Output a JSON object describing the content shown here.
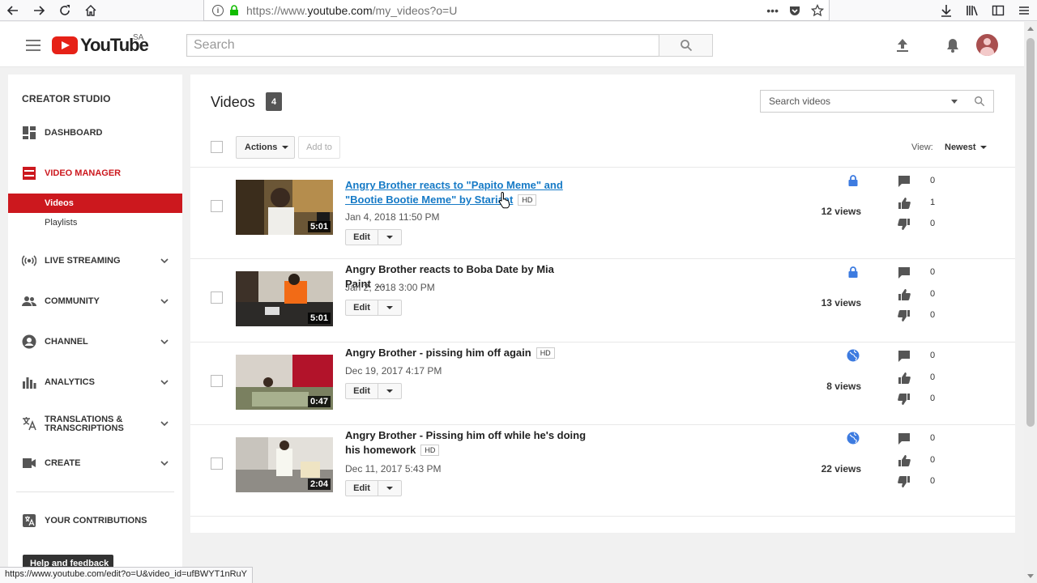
{
  "browser": {
    "url_prefix": "https://www.",
    "url_domain": "youtube.com",
    "url_path": "/my_videos?o=U",
    "status_url": "https://www.youtube.com/edit?o=U&video_id=ufBWYT1nRuY",
    "url_actions_more": "•••"
  },
  "header": {
    "logo_text": "YouTube",
    "region": "SA",
    "search_placeholder": "Search"
  },
  "sidebar": {
    "title": "CREATOR STUDIO",
    "items": [
      {
        "label": "DASHBOARD",
        "icon": "dashboard-icon"
      },
      {
        "label": "VIDEO MANAGER",
        "icon": "video-manager-icon"
      },
      {
        "label": "LIVE STREAMING",
        "icon": "live-streaming-icon"
      },
      {
        "label": "COMMUNITY",
        "icon": "community-icon"
      },
      {
        "label": "CHANNEL",
        "icon": "channel-icon"
      },
      {
        "label": "ANALYTICS",
        "icon": "analytics-icon"
      },
      {
        "label": "TRANSLATIONS &",
        "label2": "TRANSCRIPTIONS",
        "icon": "translate-icon"
      },
      {
        "label": "CREATE",
        "icon": "create-icon"
      },
      {
        "label": "YOUR CONTRIBUTIONS",
        "icon": "contributions-icon"
      }
    ],
    "sub_items": [
      "Videos",
      "Playlists"
    ],
    "help_button": "Help and feedback"
  },
  "main": {
    "title": "Videos",
    "count": "4",
    "search_placeholder": "Search videos",
    "actions_label": "Actions",
    "add_to_label": "Add to",
    "view_label": "View:",
    "sort_value": "Newest",
    "hd_label": "HD",
    "edit_label": "Edit",
    "videos": [
      {
        "title": "Angry Brother reacts to \"Papito Meme\" and \"Bootie Bootie Meme\" by Stariaat",
        "hd": true,
        "date": "Jan 4, 2018 11:50 PM",
        "duration": "5:01",
        "privacy": "private",
        "views": "12 views",
        "comments": "0",
        "likes": "1",
        "dislikes": "0"
      },
      {
        "title": "Angry Brother reacts to Boba Date by Mia Paint",
        "ellipsis": "...",
        "hd": false,
        "date": "Jan 2, 2018 3:00 PM",
        "duration": "5:01",
        "privacy": "private",
        "views": "13 views",
        "comments": "0",
        "likes": "0",
        "dislikes": "0"
      },
      {
        "title": "Angry Brother - pissing him off again",
        "hd": true,
        "date": "Dec 19, 2017 4:17 PM",
        "duration": "0:47",
        "privacy": "public",
        "views": "8 views",
        "comments": "0",
        "likes": "0",
        "dislikes": "0"
      },
      {
        "title": "Angry Brother - Pissing him off while he's doing his homework",
        "hd": true,
        "date": "Dec 11, 2017 5:43 PM",
        "duration": "2:04",
        "privacy": "public",
        "views": "22 views",
        "comments": "0",
        "likes": "0",
        "dislikes": "0"
      }
    ]
  },
  "colors": {
    "accent": "#cc181e",
    "link": "#167ac6",
    "privacy_icon": "#3d7be0"
  }
}
